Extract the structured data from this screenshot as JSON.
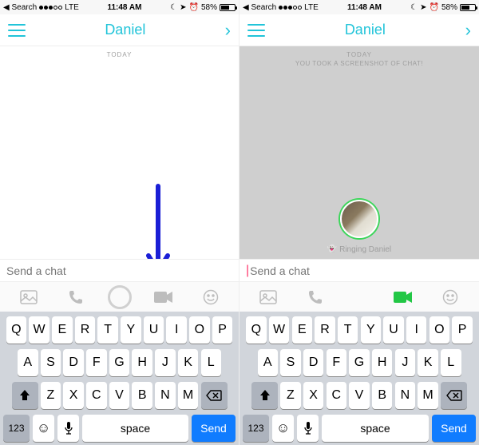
{
  "status": {
    "back": "Search",
    "carrier": "LTE",
    "time": "11:48 AM",
    "battery_pct": "58%"
  },
  "nav": {
    "title": "Daniel"
  },
  "left": {
    "day": "TODAY",
    "input_placeholder": "Send a chat"
  },
  "right": {
    "day": "TODAY",
    "subday": "YOU TOOK A SCREENSHOT OF CHAT!",
    "ringing": "Ringing Daniel",
    "input_placeholder": "Send a chat"
  },
  "keyboard": {
    "row1": [
      "Q",
      "W",
      "E",
      "R",
      "T",
      "Y",
      "U",
      "I",
      "O",
      "P"
    ],
    "row2": [
      "A",
      "S",
      "D",
      "F",
      "G",
      "H",
      "J",
      "K",
      "L"
    ],
    "row3": [
      "Z",
      "X",
      "C",
      "V",
      "B",
      "N",
      "M"
    ],
    "num": "123",
    "space": "space",
    "send": "Send"
  }
}
